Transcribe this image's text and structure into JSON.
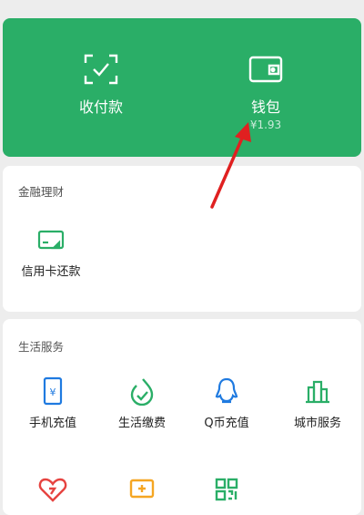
{
  "wallet_card": {
    "pay_label": "收付款",
    "wallet_label": "钱包",
    "wallet_balance": "¥1.93"
  },
  "finance": {
    "title": "金融理财",
    "items": [
      {
        "label": "信用卡还款",
        "icon": "credit-card-icon"
      }
    ]
  },
  "life": {
    "title": "生活服务",
    "items": [
      {
        "label": "手机充值",
        "icon": "phone-topup-icon"
      },
      {
        "label": "生活缴费",
        "icon": "utility-bills-icon"
      },
      {
        "label": "Q币充值",
        "icon": "qq-penguin-icon"
      },
      {
        "label": "城市服务",
        "icon": "city-buildings-icon"
      },
      {
        "label": "",
        "icon": "heart-charity-icon"
      },
      {
        "label": "",
        "icon": "tv-media-icon"
      },
      {
        "label": "",
        "icon": "qr-code-icon"
      }
    ]
  },
  "colors": {
    "brand_green": "#2aae67",
    "blue_accent": "#1f7ae0",
    "orange_accent": "#f5a623",
    "red_accent": "#e64340",
    "annotation_arrow": "#e02020"
  }
}
